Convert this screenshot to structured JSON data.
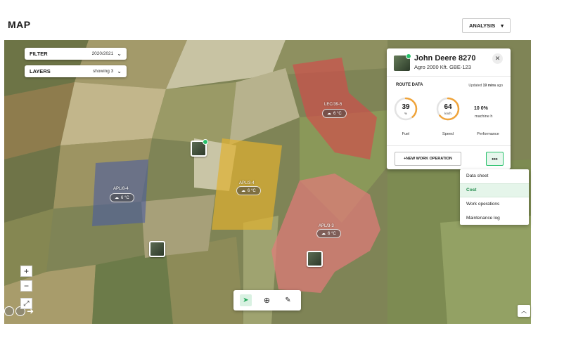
{
  "header": {
    "title": "MAP",
    "analysis_label": "ANALYSIS"
  },
  "filter": {
    "label": "FILTER",
    "value": "2020/2021"
  },
  "layers": {
    "label": "LAYERS",
    "value": "showing 3"
  },
  "fields": [
    {
      "id": "APL/8-4",
      "temp": "6 °C",
      "color": "#4a5ca0"
    },
    {
      "id": "APL/3-4",
      "temp": "6 °C",
      "color": "#e0b030"
    },
    {
      "id": "LEC/39-5",
      "temp": "6 °C",
      "color": "#d44a4a"
    },
    {
      "id": "APL/3-3",
      "temp": "6 °C",
      "color": "#e37b7b"
    }
  ],
  "vehicle_panel": {
    "name": "John Deere 8270",
    "subtitle": "Agro 2000 Kft.  GBE-123",
    "route_title": "ROUTE DATA",
    "updated_prefix": "Updated",
    "updated_value": "19 mins",
    "updated_suffix": "ago",
    "fuel": {
      "value": "39",
      "unit": "%",
      "label": "Fuel",
      "fraction": 0.39
    },
    "speed": {
      "value": "64",
      "unit": "km/h",
      "label": "Speed",
      "fraction": 0.64
    },
    "performance": {
      "value": "10 0%",
      "unit": "machine h",
      "label": "Performance"
    },
    "new_op_label": "+NEW WORK OPERATION",
    "more_label": "•••",
    "close_label": "✕"
  },
  "menu": {
    "items": [
      {
        "label": "Data sheet"
      },
      {
        "label": "Cost"
      },
      {
        "label": "Work operations"
      },
      {
        "label": "Maintenance log"
      }
    ]
  },
  "zoom": {
    "in_label": "+",
    "out_label": "−"
  },
  "colors": {
    "accent": "#26c06a",
    "gauge": "#f0a43a"
  }
}
